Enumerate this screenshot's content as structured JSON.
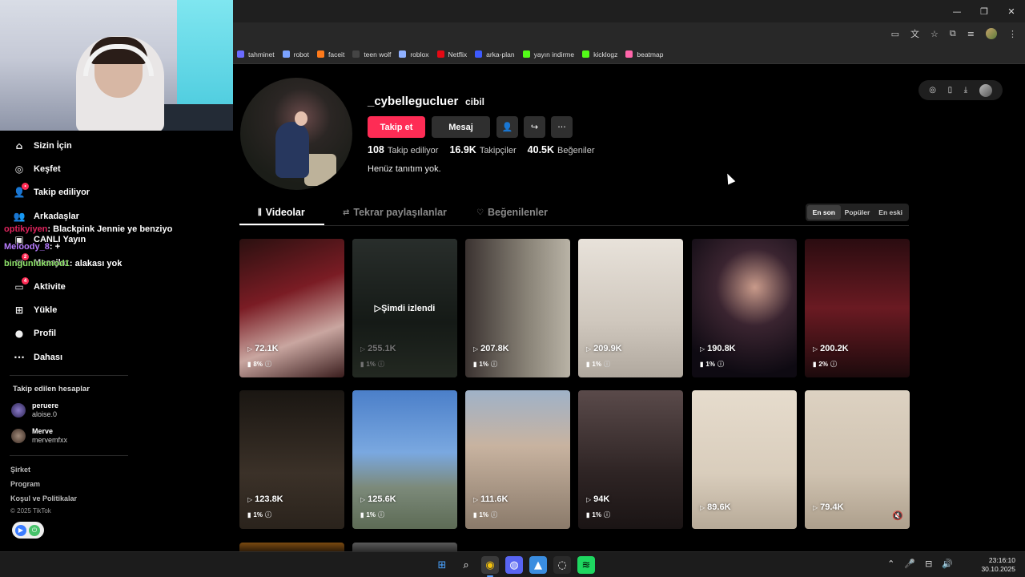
{
  "window_controls": [
    "—",
    "❐",
    "✕"
  ],
  "bookmarks": [
    {
      "label": "tahminet",
      "color": "#6b6bff"
    },
    {
      "label": "robot",
      "color": "#7aa2ff"
    },
    {
      "label": "faceit",
      "color": "#ff7a1a"
    },
    {
      "label": "teen wolf",
      "color": "#444444"
    },
    {
      "label": "roblox",
      "color": "#8fb0ff"
    },
    {
      "label": "Netflix",
      "color": "#e50914"
    },
    {
      "label": "arka-plan",
      "color": "#3d5afe"
    },
    {
      "label": "yayın indirme",
      "color": "#53fc18"
    },
    {
      "label": "kicklogz",
      "color": "#53fc18"
    },
    {
      "label": "beatmap",
      "color": "#ff66aa"
    }
  ],
  "sidebar": {
    "items": [
      {
        "label": "Sizin İçin",
        "icon": "home-icon",
        "glyph": "⌂",
        "badge": ""
      },
      {
        "label": "Keşfet",
        "icon": "compass-icon",
        "glyph": "◎",
        "badge": ""
      },
      {
        "label": "Takip ediliyor",
        "icon": "following-icon",
        "glyph": "👤",
        "badge": "•"
      },
      {
        "label": "Arkadaşlar",
        "icon": "friends-icon",
        "glyph": "👥",
        "badge": ""
      },
      {
        "label": "CANLI Yayın",
        "icon": "live-icon",
        "glyph": "▣",
        "badge": ""
      },
      {
        "label": "Mesajlar",
        "icon": "messages-icon",
        "glyph": "✉",
        "badge": "2"
      },
      {
        "label": "Aktivite",
        "icon": "activity-icon",
        "glyph": "▭",
        "badge": "4"
      },
      {
        "label": "Yükle",
        "icon": "upload-icon",
        "glyph": "⊞",
        "badge": ""
      },
      {
        "label": "Profil",
        "icon": "profile-icon",
        "glyph": "●",
        "badge": ""
      },
      {
        "label": "Dahası",
        "icon": "more-icon",
        "glyph": "···",
        "badge": ""
      }
    ],
    "following_title": "Takip edilen hesaplar",
    "following": [
      {
        "name": "peruere",
        "handle": "aloise.0"
      },
      {
        "name": "Merve",
        "handle": "mervemfxx"
      }
    ],
    "footer": [
      "Şirket",
      "Program",
      "Koşul ve Politikalar"
    ],
    "copyright": "© 2025 TikTok"
  },
  "chat": [
    {
      "user": "optikyiyen",
      "color": "#e0245e",
      "text": ": Blackpink Jennie ye benziyo"
    },
    {
      "user": "Meloody_8",
      "color": "#b77cff",
      "text": ": +"
    },
    {
      "user": "bingunlukmod1",
      "color": "#8fe36b",
      "text": ": alakası yok"
    }
  ],
  "profile": {
    "username": "_cybellegucluer",
    "nickname": "cibil",
    "follow_label": "Takip et",
    "message_label": "Mesaj",
    "stats": [
      {
        "value": "108",
        "label": "Takip ediliyor"
      },
      {
        "value": "16.9K",
        "label": "Takipçiler"
      },
      {
        "value": "40.5K",
        "label": "Beğeniler"
      }
    ],
    "bio": "Henüz tanıtım yok."
  },
  "tabs": [
    {
      "label": "Videolar",
      "icon": "grid-icon",
      "glyph": "⫼"
    },
    {
      "label": "Tekrar paylaşılanlar",
      "icon": "repost-icon",
      "glyph": "⇄"
    },
    {
      "label": "Beğenilenler",
      "icon": "heart-icon",
      "glyph": "♡"
    }
  ],
  "sort": [
    "En son",
    "Popüler",
    "En eski"
  ],
  "videos": [
    {
      "views": "72.1K",
      "pct": "8%",
      "bg": "linear-gradient(160deg,#2a1010,#7a1c24 40%,#c9a6a0 70%,#3a1d1d)"
    },
    {
      "views": "255.1K",
      "pct": "1%",
      "bg": "linear-gradient(180deg,#5a6660,#2f3a32 60%,#4d5a4a)",
      "watched": "Şimdi izlendi"
    },
    {
      "views": "207.8K",
      "pct": "1%",
      "bg": "linear-gradient(90deg,#3a3230,#8a8478 60%,#b9b3a6)"
    },
    {
      "views": "209.9K",
      "pct": "1%",
      "bg": "linear-gradient(180deg,#e8e2da,#cfc7bd 60%,#b0a89e)"
    },
    {
      "views": "190.8K",
      "pct": "1%",
      "bg": "radial-gradient(circle at 60% 35%,#c89a8a 0%,#3a2430 35%,#0e0a12 80%)"
    },
    {
      "views": "200.2K",
      "pct": "2%",
      "bg": "linear-gradient(180deg,#2a0c10,#6a1a22 50%,#1c0a0c)"
    },
    {
      "views": "123.8K",
      "pct": "1%",
      "bg": "linear-gradient(180deg,#1a1612,#3b3128 60%,#2a231c)"
    },
    {
      "views": "125.6K",
      "pct": "1%",
      "bg": "linear-gradient(180deg,#4b7fc9 0%,#7aa8e0 45%,#7c8a7a 70%,#5d6b55)"
    },
    {
      "views": "111.6K",
      "pct": "1%",
      "bg": "linear-gradient(180deg,#9fb2c8 0%,#c8b3a0 40%,#8a7a6a 100%)"
    },
    {
      "views": "94K",
      "pct": "1%",
      "bg": "linear-gradient(180deg,#5a4a4a,#2e2424 60%,#1a1414)"
    },
    {
      "views": "89.6K",
      "pct": "",
      "bg": "linear-gradient(180deg,#e6dccd,#d9cdbc 60%,#b7aa98)"
    },
    {
      "views": "79.4K",
      "pct": "",
      "bg": "linear-gradient(180deg,#ddd2c2,#cfc2b0 60%,#ad9f8c)",
      "muted": true
    }
  ],
  "taskbar": {
    "apps": [
      {
        "name": "windows-start-icon",
        "glyph": "⊞",
        "color": "#4aa3ff",
        "bg": "transparent"
      },
      {
        "name": "search-icon",
        "glyph": "⌕",
        "color": "#ffffff",
        "bg": "transparent"
      },
      {
        "name": "chrome-icon",
        "glyph": "◉",
        "color": "#f4c20d",
        "bg": "#3a3a3a"
      },
      {
        "name": "discord-icon",
        "glyph": "◍",
        "color": "#ffffff",
        "bg": "#5865f2"
      },
      {
        "name": "photos-icon",
        "glyph": "▲",
        "color": "#ffffff",
        "bg": "#3a8de0"
      },
      {
        "name": "obs-icon",
        "glyph": "◌",
        "color": "#ffffff",
        "bg": "#2a2a2a"
      },
      {
        "name": "spotify-icon",
        "glyph": "≋",
        "color": "#000000",
        "bg": "#1ed760"
      }
    ],
    "tray": [
      "⌃",
      "🎤",
      "⊟",
      "🔊"
    ],
    "time": "23:16:10",
    "date": "30.10.2025"
  }
}
